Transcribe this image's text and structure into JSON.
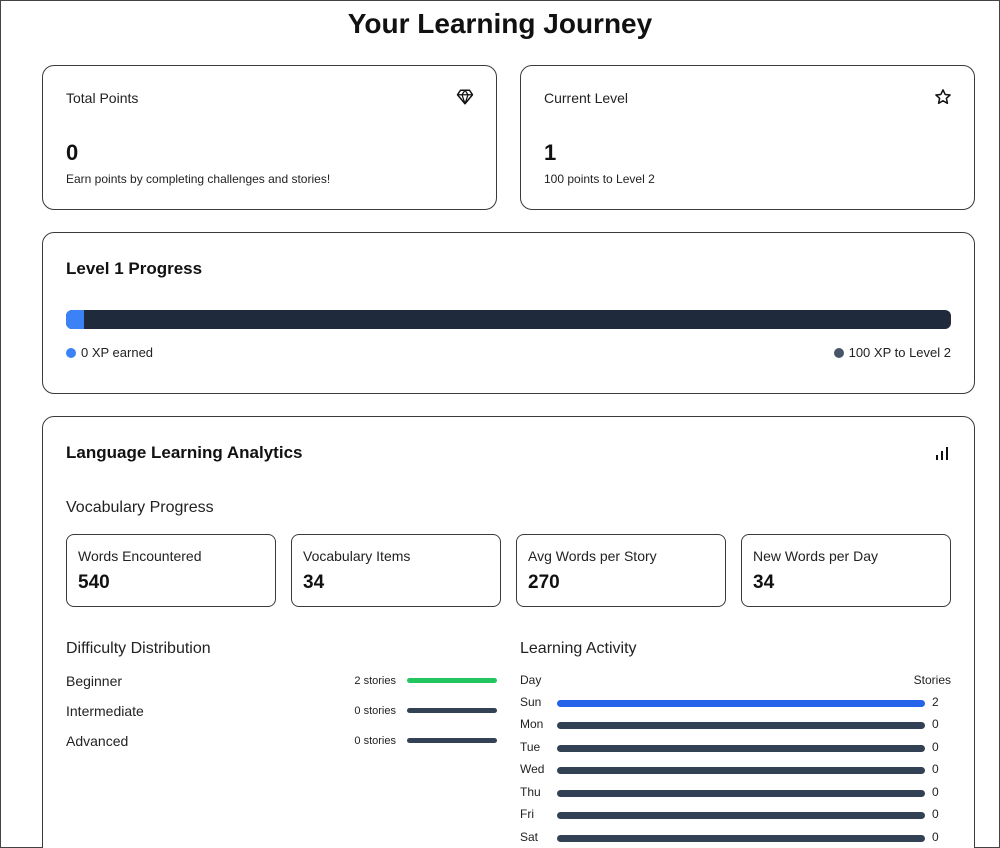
{
  "page": {
    "title": "Your Learning Journey"
  },
  "stats": {
    "total_points": {
      "label": "Total Points",
      "value": "0",
      "desc": "Earn points by completing challenges and stories!",
      "icon": "diamond-icon"
    },
    "current_level": {
      "label": "Current Level",
      "value": "1",
      "desc": "100 points to Level 2",
      "icon": "star-icon"
    }
  },
  "progress": {
    "title": "Level 1 Progress",
    "fraction": 0.02,
    "earned_label": "0 XP earned",
    "remaining_label": "100 XP to Level 2"
  },
  "analytics": {
    "title": "Language Learning Analytics",
    "icon": "bar-chart-icon",
    "vocab_title": "Vocabulary Progress",
    "vocab": [
      {
        "label": "Words Encountered",
        "value": "540"
      },
      {
        "label": "Vocabulary Items",
        "value": "34"
      },
      {
        "label": "Avg Words per Story",
        "value": "270"
      },
      {
        "label": "New Words per Day",
        "value": "34"
      }
    ],
    "difficulty_title": "Difficulty Distribution",
    "difficulty": [
      {
        "name": "Beginner",
        "count": "2 stories",
        "color": "#22c55e"
      },
      {
        "name": "Intermediate",
        "count": "0 stories",
        "color": "#334155"
      },
      {
        "name": "Advanced",
        "count": "0 stories",
        "color": "#334155"
      }
    ],
    "activity_title": "Learning Activity",
    "activity_head_day": "Day",
    "activity_head_stories": "Stories",
    "activity": [
      {
        "day": "Sun",
        "value": "2",
        "color": "#2563eb"
      },
      {
        "day": "Mon",
        "value": "0",
        "color": "#334155"
      },
      {
        "day": "Tue",
        "value": "0",
        "color": "#334155"
      },
      {
        "day": "Wed",
        "value": "0",
        "color": "#334155"
      },
      {
        "day": "Thu",
        "value": "0",
        "color": "#334155"
      },
      {
        "day": "Fri",
        "value": "0",
        "color": "#334155"
      },
      {
        "day": "Sat",
        "value": "0",
        "color": "#334155"
      }
    ]
  },
  "colors": {
    "accent": "#3b82f6",
    "track": "#1f2a3c",
    "success": "#22c55e",
    "muted": "#475569"
  }
}
